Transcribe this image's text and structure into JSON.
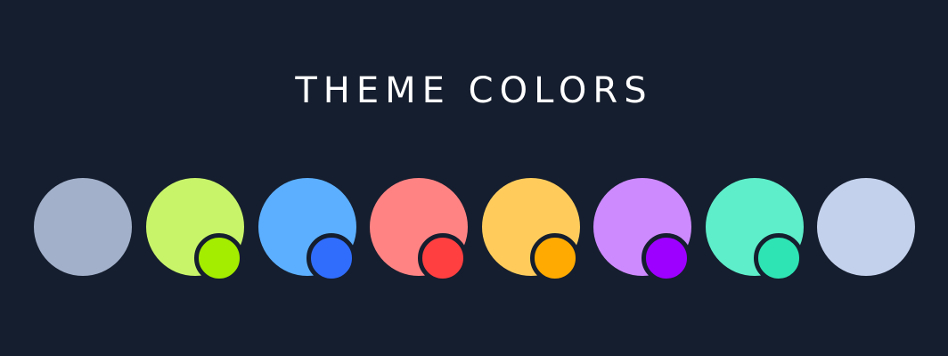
{
  "header": {
    "title": "THEME COLORS"
  },
  "swatches": [
    {
      "name": "slate",
      "main": "#a2b0ca",
      "accent": null
    },
    {
      "name": "lime",
      "main": "#c8f46a",
      "accent": "#a4ec00"
    },
    {
      "name": "blue",
      "main": "#5caffe",
      "accent": "#306dfc"
    },
    {
      "name": "red",
      "main": "#ff8383",
      "accent": "#ff3f40"
    },
    {
      "name": "yellow",
      "main": "#ffcc5c",
      "accent": "#ffaa00"
    },
    {
      "name": "purple",
      "main": "#cd8afe",
      "accent": "#9d00ff"
    },
    {
      "name": "teal",
      "main": "#5eeeca",
      "accent": "#2fe4b4"
    },
    {
      "name": "lavender",
      "main": "#c4d1ec",
      "accent": null
    }
  ],
  "colors": {
    "background": "#151e2e",
    "text": "#ffffff"
  }
}
